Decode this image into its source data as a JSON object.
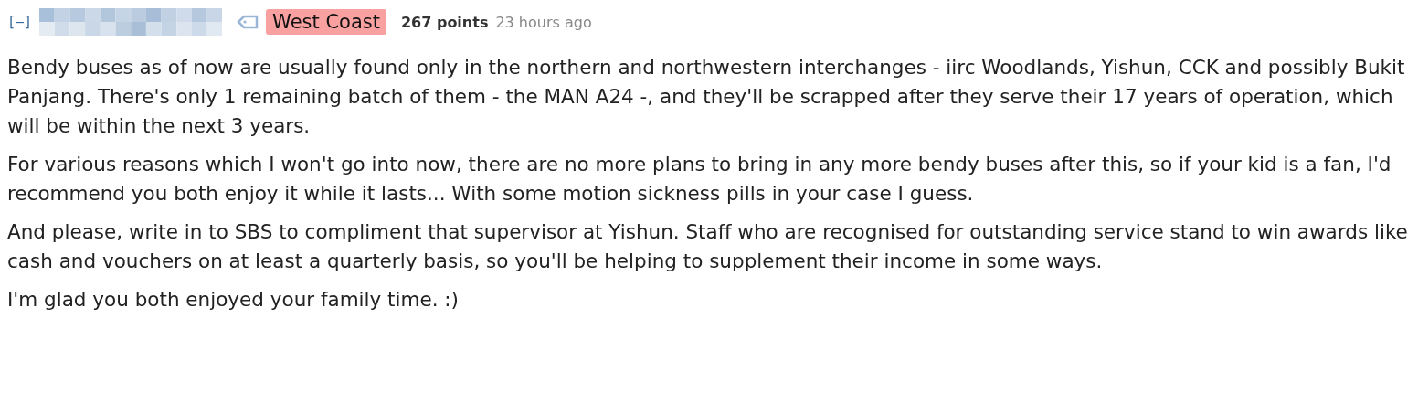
{
  "comment": {
    "collapse_toggle": "[–]",
    "flair": "West Coast",
    "points": "267 points",
    "time": "23 hours ago",
    "paragraphs": [
      "Bendy buses as of now are usually found only in the northern and northwestern interchanges - iirc Woodlands, Yishun, CCK and possibly Bukit Panjang. There's only 1 remaining batch of them - the MAN A24 -, and they'll be scrapped after they serve their 17 years of operation, which will be within the next 3 years.",
      "For various reasons which I won't go into now, there are no more plans to bring in any more bendy buses after this, so if your kid is a fan, I'd recommend you both enjoy it while it lasts... With some motion sickness pills in your case I guess.",
      "And please, write in to SBS to compliment that supervisor at Yishun. Staff who are recognised for outstanding service stand to win awards like cash and vouchers on at least a quarterly basis, so you'll be helping to supplement their income in some ways.",
      "I'm glad you both enjoyed your family time. :)"
    ]
  }
}
